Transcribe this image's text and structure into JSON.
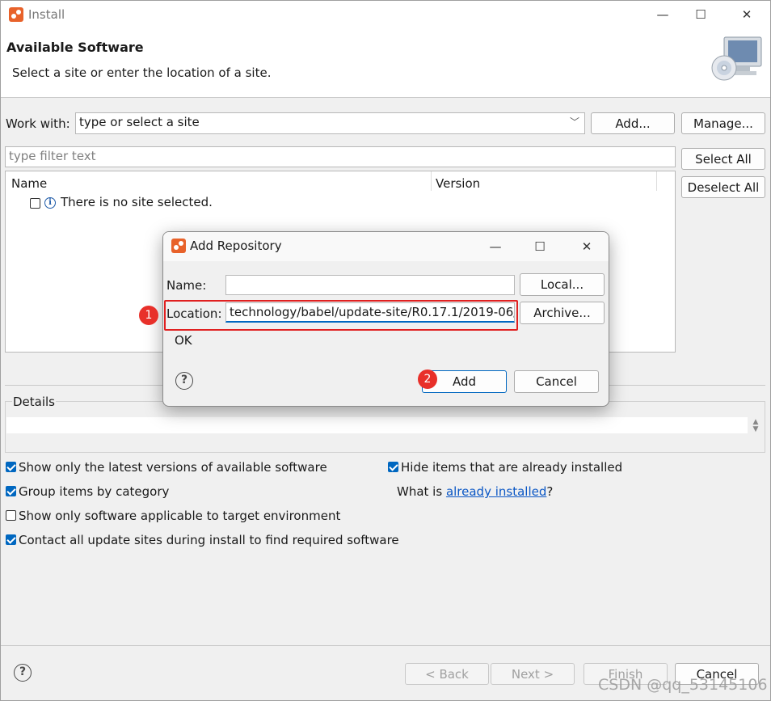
{
  "window": {
    "title": "Install",
    "min_glyph": "—",
    "max_glyph": "☐",
    "close_glyph": "✕"
  },
  "header": {
    "title": "Available Software",
    "subtitle": "Select a site or enter the location of a site."
  },
  "work_with": {
    "label": "Work with:",
    "combo_placeholder": "type or select a site",
    "add_button": "Add...",
    "manage_button": "Manage..."
  },
  "filter": {
    "placeholder": "type filter text"
  },
  "side_buttons": {
    "select_all": "Select All",
    "deselect_all": "Deselect All"
  },
  "table": {
    "columns": [
      "Name",
      "Version"
    ],
    "rows": [
      {
        "text": "There is no site selected.",
        "checked": false,
        "icon": "info-icon"
      }
    ]
  },
  "details": {
    "label": "Details"
  },
  "options": {
    "latest_versions": {
      "label": "Show only the latest versions of available software",
      "checked": true
    },
    "group_by_category": {
      "label": "Group items by category",
      "checked": true
    },
    "applicable_target": {
      "label": "Show only software applicable to target environment",
      "checked": false
    },
    "contact_update_sites": {
      "label": "Contact all update sites during install to find required software",
      "checked": true
    },
    "hide_installed": {
      "label": "Hide items that are already installed",
      "checked": true
    },
    "what_is_prefix": "What is ",
    "what_is_link": "already installed",
    "what_is_suffix": "?"
  },
  "footer": {
    "back": "< Back",
    "next": "Next >",
    "finish": "Finish",
    "cancel": "Cancel"
  },
  "dialog": {
    "title": "Add Repository",
    "name_label": "Name:",
    "name_value": "",
    "local_button": "Local...",
    "location_label": "Location:",
    "location_value": "technology/babel/update-site/R0.17.1/2019-06/",
    "archive_button": "Archive...",
    "status_text": "OK",
    "add_button": "Add",
    "cancel_button": "Cancel"
  },
  "annotations": {
    "badge_1": "1",
    "badge_2": "2",
    "highlight_color": "#e02020"
  },
  "watermark": "CSDN @qq_53145106",
  "colors": {
    "accent": "#0067c0",
    "link": "#0b57c5",
    "app_icon": "#e8622a"
  }
}
